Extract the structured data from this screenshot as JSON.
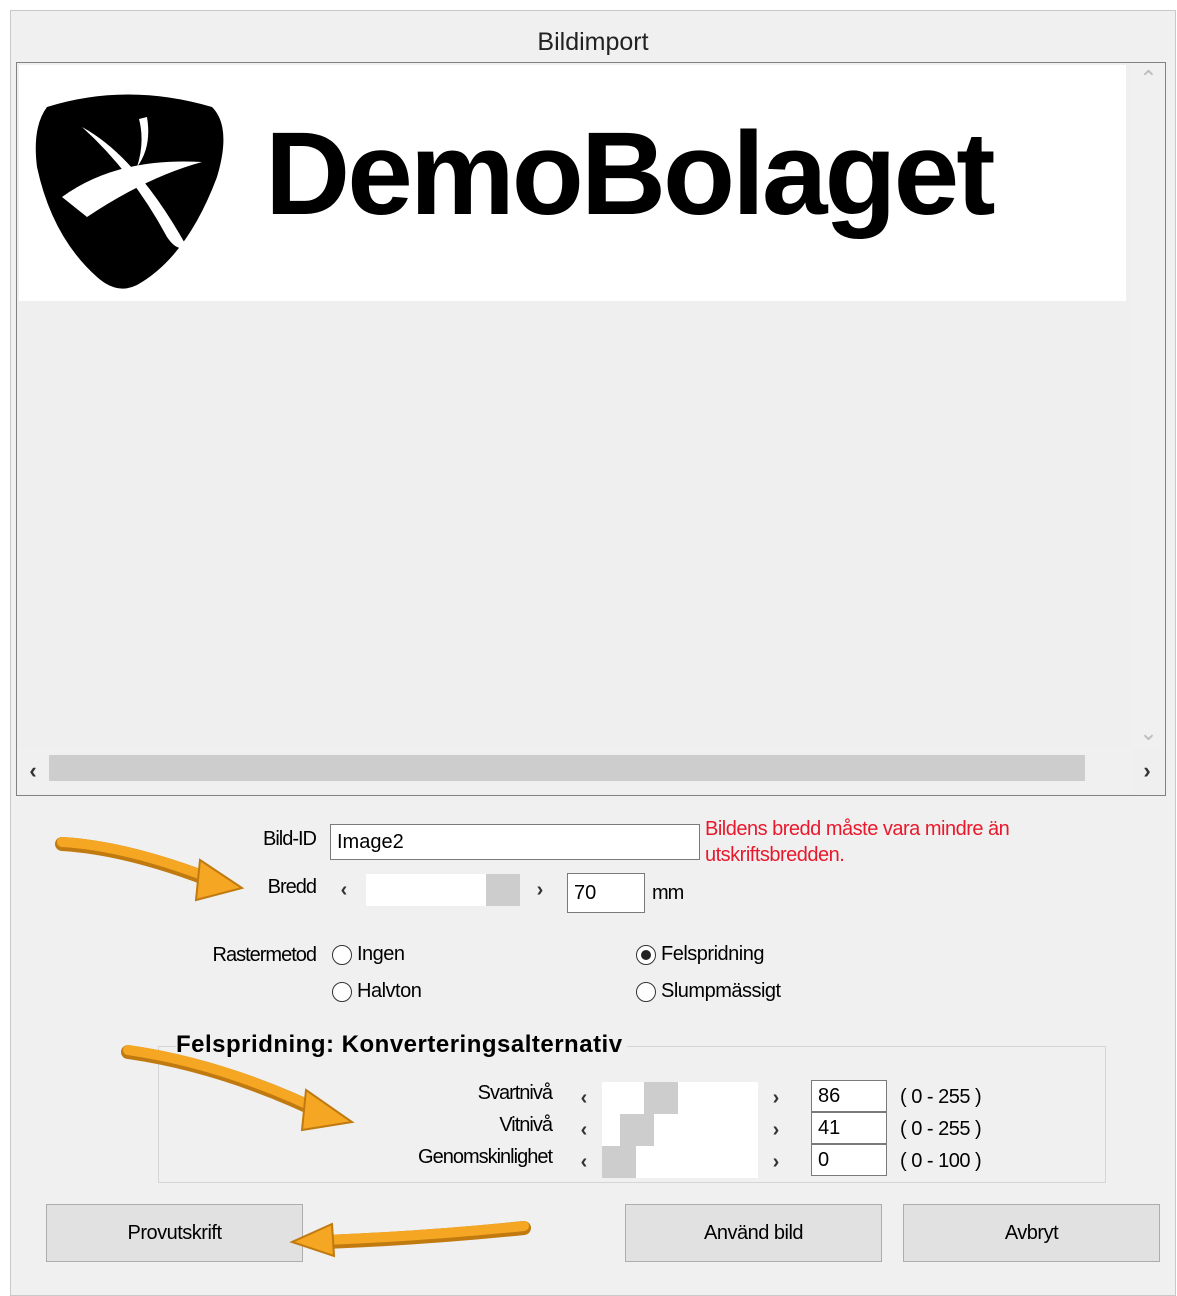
{
  "window": {
    "title": "Bildimport"
  },
  "preview": {
    "logo_text": "DemoBolaget"
  },
  "form": {
    "bild_id_label": "Bild-ID",
    "bild_id_value": "Image2",
    "error_message": "Bildens bredd måste vara mindre än utskriftsbredden.",
    "bredd_label": "Bredd",
    "bredd_value": "70",
    "bredd_unit": "mm",
    "raster_label": "Rastermetod",
    "raster_options": [
      {
        "label": "Ingen",
        "checked": false
      },
      {
        "label": "Felspridning",
        "checked": true
      },
      {
        "label": "Halvton",
        "checked": false
      },
      {
        "label": "Slumpmässigt",
        "checked": false
      }
    ]
  },
  "conversion": {
    "title": "Felspridning: Konverteringsalternativ",
    "rows": [
      {
        "label": "Svartnivå",
        "value": "86",
        "range": "( 0 - 255 )"
      },
      {
        "label": "Vitnivå",
        "value": "41",
        "range": "( 0 - 255 )"
      },
      {
        "label": "Genomskinlighet",
        "value": "0",
        "range": "( 0 - 100 )"
      }
    ]
  },
  "buttons": {
    "test_print": "Provutskrift",
    "use_image": "Använd bild",
    "cancel": "Avbryt"
  },
  "colors": {
    "error": "#e8192c",
    "annotation_arrow": "#f5a623"
  }
}
